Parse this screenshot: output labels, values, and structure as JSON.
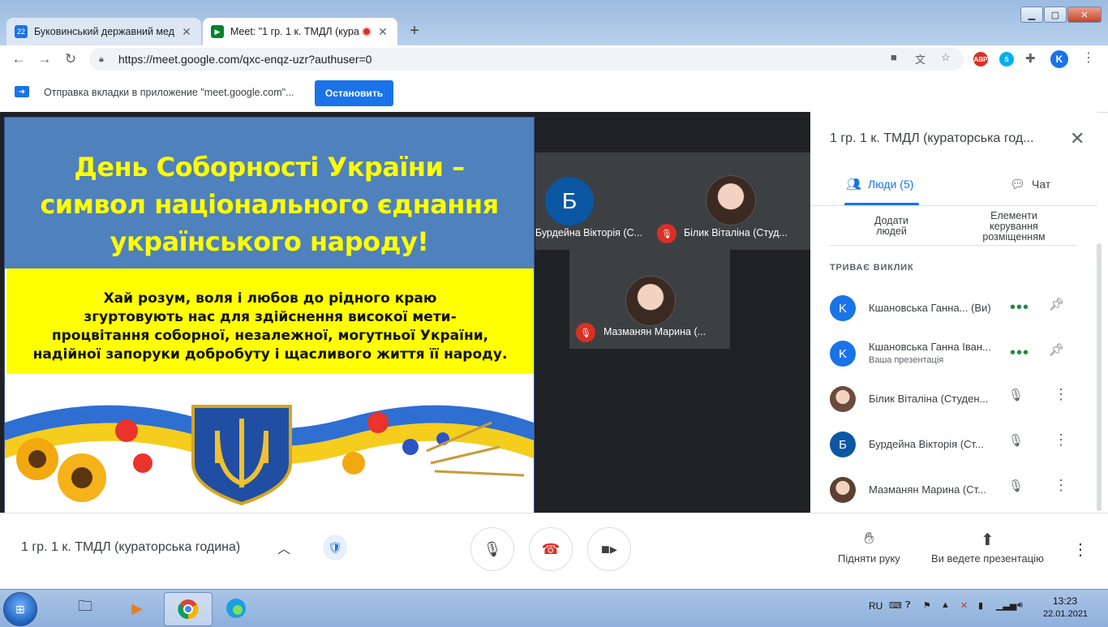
{
  "browser": {
    "tabs": [
      {
        "title": "Буковинський державний мед",
        "favicon_text": "22",
        "favicon_color": "#1a73e8"
      },
      {
        "title": "Meet: \"1 гр. 1 к. ТМДЛ (кура",
        "favicon_color": "#00832d",
        "recording": true
      }
    ],
    "url": "https://meet.google.com/qxc-enqz-uzr?authuser=0",
    "profile_initial": "K",
    "extensions": [
      "ABP",
      "S"
    ],
    "infobar": {
      "message": "Отправка вкладки в приложение \"meet.google.com\"...",
      "stop_label": "Остановить"
    }
  },
  "slide": {
    "title_lines": [
      "День Соборності України –",
      "символ національного єднання",
      "українського народу!"
    ],
    "quote_lines": [
      "Хай розум, воля і любов до рідного краю",
      "згуртовують нас для здійснення високої мети-",
      "процвітання соборної, незалежної, могутньої України,",
      "надійної запоруки добробуту і щасливого життя її народу."
    ],
    "colors": {
      "blue": "#4f81bd",
      "yellow": "#ffff00"
    }
  },
  "tiles": [
    {
      "name": "Бурдейна Вікторія (С...",
      "avatar": "Б",
      "muted": false
    },
    {
      "name": "Білик Віталіна (Студ...",
      "avatar": "photo",
      "muted": true
    },
    {
      "name": "Мазманян Марина (...",
      "avatar": "photo",
      "muted": true
    }
  ],
  "panel": {
    "title": "1 гр. 1 к. ТМДЛ (кураторська год...",
    "tab_people": "Люди (5)",
    "tab_chat": "Чат",
    "add_people": "Додати людей",
    "layout_controls": "Елементи керування розміщенням",
    "section_heading": "ТРИВАЄ ВИКЛИК",
    "participants": [
      {
        "name": "Кшановська Ганна...",
        "suffix": "(Ви)",
        "sub": "",
        "avatar": "K",
        "avatar_color": "#1a73e8",
        "actions": "dots-pin"
      },
      {
        "name": "Кшановська Ганна Іван...",
        "suffix": "",
        "sub": "Ваша презентація",
        "avatar": "K",
        "avatar_color": "#1a73e8",
        "actions": "dots-pin"
      },
      {
        "name": "Білик Віталіна (Студен...",
        "suffix": "",
        "sub": "",
        "avatar": "photo",
        "avatar_color": "#c8a596",
        "actions": "mic-more"
      },
      {
        "name": "Бурдейна Вікторія (Ст...",
        "suffix": "",
        "sub": "",
        "avatar": "Б",
        "avatar_color": "#0b57a4",
        "actions": "mic-more"
      },
      {
        "name": "Мазманян Марина (Ст...",
        "suffix": "",
        "sub": "",
        "avatar": "photo",
        "avatar_color": "#b89a8e",
        "actions": "mic-more"
      }
    ]
  },
  "controls": {
    "meeting_name": "1 гр. 1 к. ТМДЛ (кураторська година)",
    "raise_hand": "Підняти руку",
    "presenting": "Ви ведете презентацію",
    "hangup_color": "#d93025"
  },
  "taskbar": {
    "lang": "RU",
    "time": "13:23",
    "date": "22.01.2021"
  }
}
